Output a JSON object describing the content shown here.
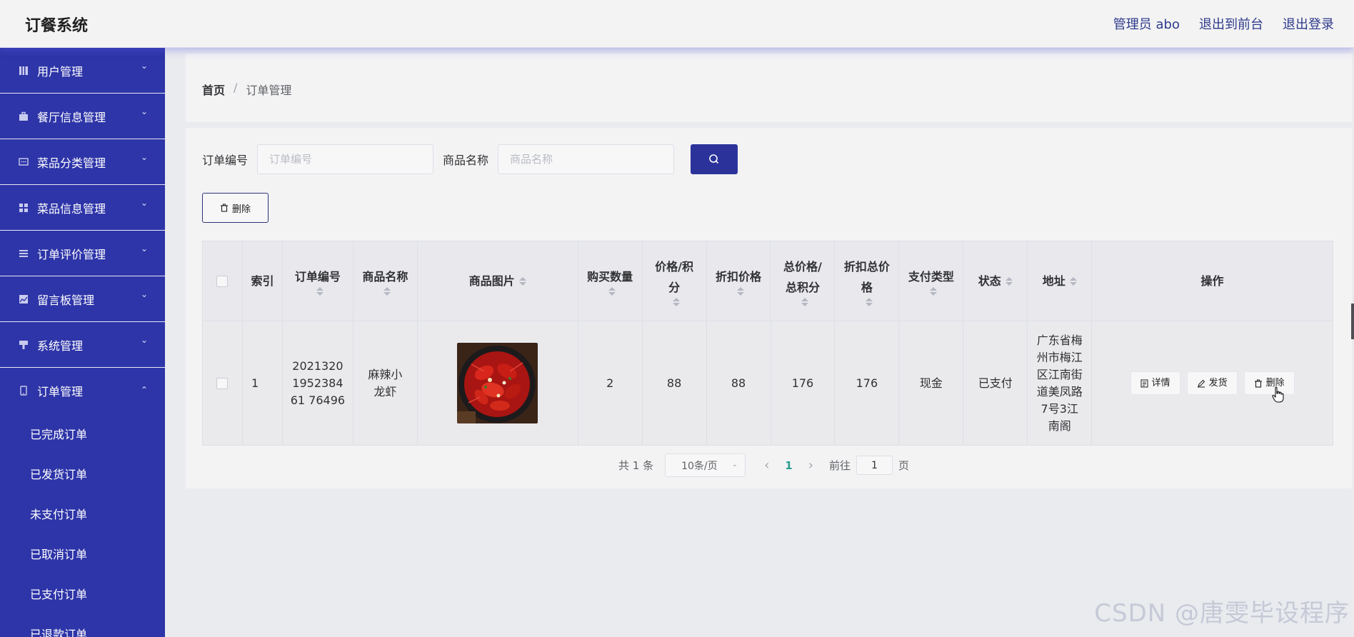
{
  "header": {
    "brand": "订餐系统",
    "links": [
      "管理员 abo",
      "退出到前台",
      "退出登录"
    ]
  },
  "sidebar": {
    "items": [
      {
        "label": "用户管理",
        "icon": "book-icon"
      },
      {
        "label": "餐厅信息管理",
        "icon": "briefcase-icon"
      },
      {
        "label": "菜品分类管理",
        "icon": "chat-icon"
      },
      {
        "label": "菜品信息管理",
        "icon": "grid-icon"
      },
      {
        "label": "订单评价管理",
        "icon": "list-icon"
      },
      {
        "label": "留言板管理",
        "icon": "picture-icon"
      },
      {
        "label": "系统管理",
        "icon": "brush-icon"
      },
      {
        "label": "订单管理",
        "icon": "phone-icon"
      }
    ],
    "sub_items": [
      "已完成订单",
      "已发货订单",
      "未支付订单",
      "已取消订单",
      "已支付订单",
      "已退款订单"
    ]
  },
  "breadcrumb": {
    "home": "首页",
    "separator": "/",
    "current": "订单管理"
  },
  "search": {
    "order_no_label": "订单编号",
    "order_no_placeholder": "订单编号",
    "product_label": "商品名称",
    "product_placeholder": "商品名称"
  },
  "toolbar": {
    "delete_label": "删除"
  },
  "table": {
    "headers": [
      "索引",
      "订单编号",
      "商品名称",
      "商品图片",
      "购买数量",
      "价格/积分",
      "折扣价格",
      "总价格/总积分",
      "折扣总价格",
      "支付类型",
      "状态",
      "地址",
      "操作"
    ],
    "rows": [
      {
        "index": "1",
        "order_no": "2021320195238461 76496",
        "product": "麻辣小龙虾",
        "quantity": "2",
        "price": "88",
        "discount_price": "88",
        "total": "176",
        "discount_total": "176",
        "pay_type": "现金",
        "status": "已支付",
        "address": "广东省梅州市梅江区江南街道美凤路7号3江南阁"
      }
    ],
    "actions": {
      "detail": "详情",
      "ship": "发货",
      "delete": "删除"
    }
  },
  "pagination": {
    "total": "共 1 条",
    "page_size": "10条/页",
    "current_page": "1",
    "goto_label": "前往",
    "goto_value": "1",
    "page_unit": "页"
  },
  "watermark": "CSDN @唐雯毕设程序",
  "colors": {
    "sidebar": "#2e35a8",
    "accent": "#2b339b",
    "active_page": "#2a9d8f"
  }
}
